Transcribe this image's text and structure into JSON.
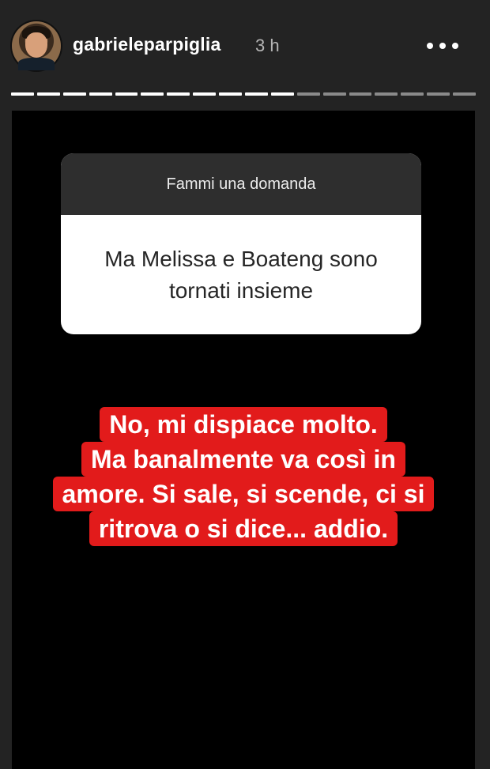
{
  "header": {
    "username": "gabrieleparpiglia",
    "time": "3 h"
  },
  "progress": {
    "segments_total": 18,
    "segments_viewed": 11
  },
  "question": {
    "prompt": "Fammi una domanda",
    "text": "Ma Melissa e Boateng sono tornati insieme"
  },
  "answer": {
    "lines": [
      "No, mi dispiace molto.",
      "Ma banalmente va così in",
      "amore. Si sale, si scende, ci si",
      "ritrova o si dice... addio."
    ]
  },
  "colors": {
    "answer_background": "#e21b1b",
    "story_background": "#000000",
    "chrome_background": "#232323"
  },
  "icons": [
    "avatar-photo",
    "more-options-icon"
  ]
}
